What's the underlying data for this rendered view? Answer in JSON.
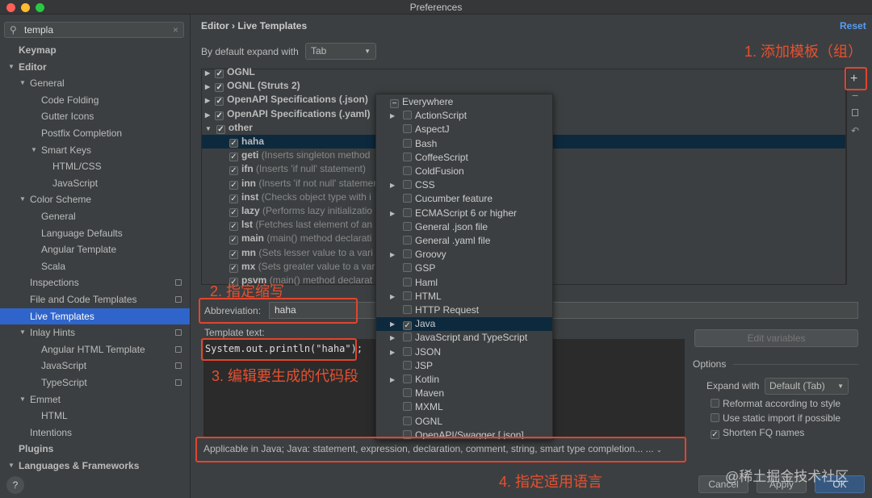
{
  "window": {
    "title": "Preferences"
  },
  "search": {
    "value": "templa"
  },
  "sidebar": {
    "items": [
      {
        "label": "Keymap",
        "bold": true
      },
      {
        "label": "Editor",
        "bold": true
      },
      {
        "label": "General"
      },
      {
        "label": "Code Folding"
      },
      {
        "label": "Gutter Icons"
      },
      {
        "label": "Postfix Completion"
      },
      {
        "label": "Smart Keys"
      },
      {
        "label": "HTML/CSS"
      },
      {
        "label": "JavaScript"
      },
      {
        "label": "Color Scheme"
      },
      {
        "label": "General"
      },
      {
        "label": "Language Defaults"
      },
      {
        "label": "Angular Template"
      },
      {
        "label": "Scala"
      },
      {
        "label": "Inspections"
      },
      {
        "label": "File and Code Templates"
      },
      {
        "label": "Live Templates"
      },
      {
        "label": "Inlay Hints"
      },
      {
        "label": "Angular HTML Template"
      },
      {
        "label": "JavaScript"
      },
      {
        "label": "TypeScript"
      },
      {
        "label": "Emmet"
      },
      {
        "label": "HTML"
      },
      {
        "label": "Intentions"
      },
      {
        "label": "Plugins",
        "bold": true
      },
      {
        "label": "Languages & Frameworks",
        "bold": true
      }
    ]
  },
  "breadcrumb": {
    "parent": "Editor",
    "current": "Live Templates"
  },
  "reset_label": "Reset",
  "expand_default": {
    "label": "By default expand with",
    "value": "Tab"
  },
  "groups": [
    {
      "name": "OGNL"
    },
    {
      "name": "OGNL (Struts 2)"
    },
    {
      "name": "OpenAPI Specifications (.json)"
    },
    {
      "name": "OpenAPI Specifications (.yaml)"
    },
    {
      "name": "other"
    }
  ],
  "templates": [
    {
      "abbr": "haha",
      "desc": ""
    },
    {
      "abbr": "geti",
      "desc": "(Inserts singleton method"
    },
    {
      "abbr": "ifn",
      "desc": "(Inserts 'if null' statement)"
    },
    {
      "abbr": "inn",
      "desc": "(Inserts 'if not null' statement"
    },
    {
      "abbr": "inst",
      "desc": "(Checks object type with i"
    },
    {
      "abbr": "lazy",
      "desc": "(Performs lazy initializatio"
    },
    {
      "abbr": "lst",
      "desc": "(Fetches last element of an"
    },
    {
      "abbr": "main",
      "desc": "(main() method declarati"
    },
    {
      "abbr": "mn",
      "desc": "(Sets lesser value to a vari"
    },
    {
      "abbr": "mx",
      "desc": "(Sets greater value to a var"
    },
    {
      "abbr": "psvm",
      "desc": "(main() method declarat"
    }
  ],
  "context_popup": {
    "items": [
      {
        "label": "Everywhere",
        "arrow": false,
        "checked": "partial"
      },
      {
        "label": "ActionScript",
        "arrow": true
      },
      {
        "label": "AspectJ"
      },
      {
        "label": "Bash"
      },
      {
        "label": "CoffeeScript"
      },
      {
        "label": "ColdFusion"
      },
      {
        "label": "CSS",
        "arrow": true
      },
      {
        "label": "Cucumber feature"
      },
      {
        "label": "ECMAScript 6 or higher",
        "arrow": true
      },
      {
        "label": "General .json file"
      },
      {
        "label": "General .yaml file"
      },
      {
        "label": "Groovy",
        "arrow": true
      },
      {
        "label": "GSP"
      },
      {
        "label": "Haml"
      },
      {
        "label": "HTML",
        "arrow": true
      },
      {
        "label": "HTTP Request"
      },
      {
        "label": "Java",
        "arrow": true,
        "checked": true,
        "selected": true
      },
      {
        "label": "JavaScript and TypeScript",
        "arrow": true
      },
      {
        "label": "JSON",
        "arrow": true
      },
      {
        "label": "JSP"
      },
      {
        "label": "Kotlin",
        "arrow": true
      },
      {
        "label": "Maven"
      },
      {
        "label": "MXML"
      },
      {
        "label": "OGNL"
      },
      {
        "label": "OpenAPI/Swagger [.json]"
      }
    ]
  },
  "abbreviation": {
    "label": "Abbreviation:",
    "value": "haha"
  },
  "template_text": {
    "label": "Template text:",
    "value": "System.out.println(\"haha\");"
  },
  "edit_variables_label": "Edit variables",
  "options": {
    "title": "Options",
    "expand_with_label": "Expand with",
    "expand_with_value": "Default (Tab)",
    "checkboxes": [
      {
        "label": "Reformat according to style",
        "checked": false
      },
      {
        "label": "Use static import if possible",
        "checked": false
      },
      {
        "label": "Shorten FQ names",
        "checked": true
      }
    ]
  },
  "applicable": {
    "text": "Applicable in Java; Java: statement, expression, declaration, comment, string, smart type completion...",
    "more": "..."
  },
  "buttons": {
    "cancel": "Cancel",
    "apply": "Apply",
    "ok": "OK"
  },
  "annotations": {
    "a1": "1. 添加模板（组）",
    "a2": "2. 指定缩写",
    "a3": "3. 编辑要生成的代码段",
    "a4": "4. 指定适用语言"
  },
  "watermark": "@稀土掘金技术社区",
  "colors": {
    "selection": "#2f65ca",
    "annotation": "#e0452f",
    "background": "#3c3f41"
  }
}
